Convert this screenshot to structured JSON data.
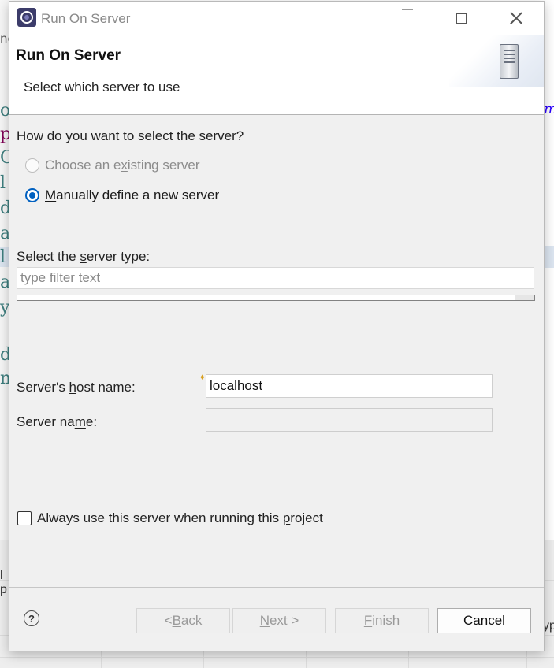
{
  "background": {
    "left_glyphs": [
      "o",
      "p",
      "C",
      "l",
      "d",
      "a",
      "l",
      "a",
      "y",
      "d",
      "m"
    ],
    "right_glyph": "m",
    "right_bottom_text": "yp",
    "left_top_text": "nc",
    "left_bottom_text": "l p"
  },
  "window": {
    "title": "Run On Server",
    "minimize_label": "Minimize",
    "maximize_label": "Maximize",
    "close_label": "Close"
  },
  "header": {
    "title": "Run On Server",
    "description": "Select which server to use"
  },
  "selection": {
    "question": "How do you want to select the server?",
    "options": [
      {
        "label_pre": "Choose an e",
        "label_mnemonic": "x",
        "label_post": "isting server",
        "selected": false,
        "enabled": false
      },
      {
        "label_pre": "",
        "label_mnemonic": "M",
        "label_post": "anually define a new server",
        "selected": true,
        "enabled": true
      }
    ]
  },
  "server_type": {
    "label_pre": "Select the ",
    "label_mnemonic": "s",
    "label_post": "erver type:",
    "filter_placeholder": "type filter text"
  },
  "host_name": {
    "label_pre": "Server's ",
    "label_mnemonic": "h",
    "label_post": "ost name:",
    "value": "localhost"
  },
  "server_name": {
    "label_pre": "Server na",
    "label_mnemonic": "m",
    "label_post": "e:",
    "value": ""
  },
  "always_use": {
    "label_pre": "Always use this server when running this ",
    "label_mnemonic": "p",
    "label_post": "roject",
    "checked": false
  },
  "buttons": {
    "back": {
      "pre": "< ",
      "mnemonic": "B",
      "post": "ack"
    },
    "next": {
      "pre": "",
      "mnemonic": "N",
      "post": "ext >"
    },
    "finish": {
      "pre": "",
      "mnemonic": "F",
      "post": "inish"
    },
    "cancel": "Cancel",
    "help": "?"
  },
  "colors": {
    "accent": "#0060c0",
    "dialog_bg": "#f0f0f0",
    "disabled_text": "#8c8c8c"
  }
}
